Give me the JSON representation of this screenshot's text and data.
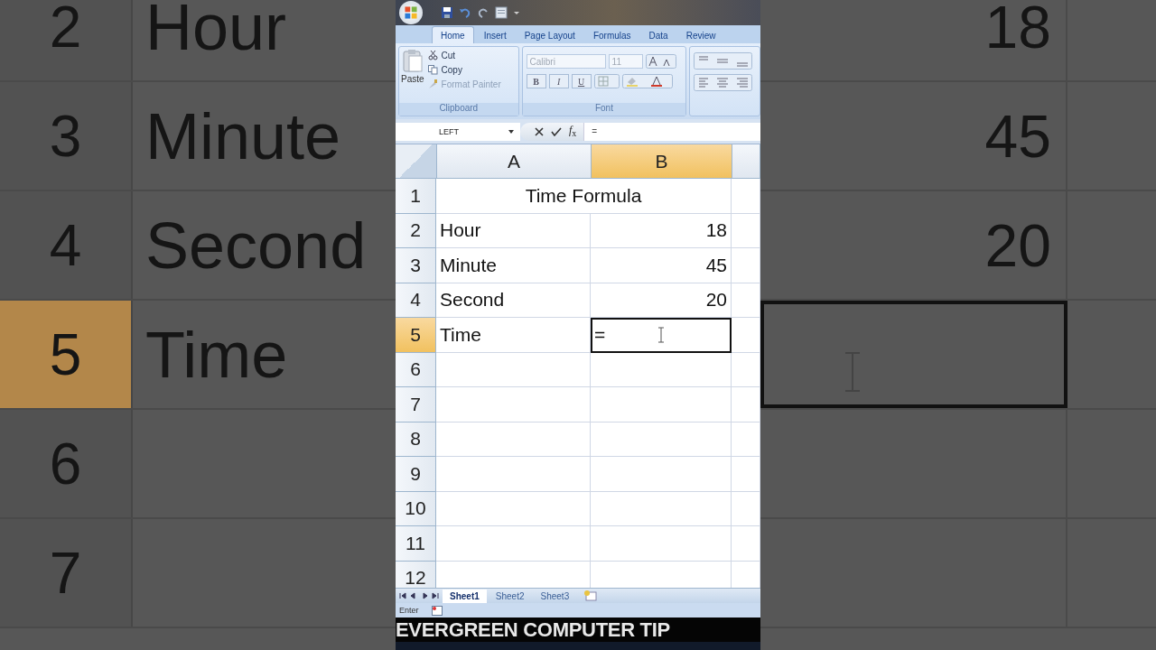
{
  "backdrop": {
    "rows": [
      {
        "number": "2",
        "label": "Hour",
        "value": "18",
        "selected": false
      },
      {
        "number": "3",
        "label": "Minute",
        "value": "45",
        "selected": false
      },
      {
        "number": "4",
        "label": "Second",
        "value": "20",
        "selected": false
      },
      {
        "number": "5",
        "label": "Time",
        "selected": true
      },
      {
        "number": "6",
        "selected": false
      },
      {
        "number": "7",
        "selected": false
      }
    ]
  },
  "ribbon": {
    "tabs": [
      {
        "label": "Home",
        "selected": true
      },
      {
        "label": "Insert",
        "selected": false
      },
      {
        "label": "Page Layout",
        "selected": false
      },
      {
        "label": "Formulas",
        "selected": false
      },
      {
        "label": "Data",
        "selected": false
      },
      {
        "label": "Review",
        "selected": false
      }
    ],
    "clipboard": {
      "paste": "Paste",
      "cut": "Cut",
      "copy": "Copy",
      "format_painter": "Format Painter",
      "label": "Clipboard"
    },
    "font": {
      "name": "Calibri",
      "size": "11",
      "bold": "B",
      "italic": "I",
      "underline": "U",
      "label": "Font"
    }
  },
  "formula_bar": {
    "name_box": "LEFT",
    "function_label": "*f*$_{x}$",
    "formula": "="
  },
  "sheet": {
    "columns": [
      {
        "label": "A",
        "selected": false
      },
      {
        "label": "B",
        "selected": true
      }
    ],
    "rows": [
      {
        "number": "1",
        "selected": false,
        "kind": "merged",
        "text": "Time Formula"
      },
      {
        "number": "2",
        "selected": false,
        "kind": "pair",
        "a": "Hour",
        "b": "18"
      },
      {
        "number": "3",
        "selected": false,
        "kind": "pair",
        "a": "Minute",
        "b": "45"
      },
      {
        "number": "4",
        "selected": false,
        "kind": "pair",
        "a": "Second",
        "b": "20"
      },
      {
        "number": "5",
        "selected": true,
        "kind": "pair",
        "a": "Time",
        "b": "=",
        "editing": true
      },
      {
        "number": "6",
        "selected": false,
        "kind": "empty"
      },
      {
        "number": "7",
        "selected": false,
        "kind": "empty"
      },
      {
        "number": "8",
        "selected": false,
        "kind": "empty"
      },
      {
        "number": "9",
        "selected": false,
        "kind": "empty"
      },
      {
        "number": "10",
        "selected": false,
        "kind": "empty"
      },
      {
        "number": "11",
        "selected": false,
        "kind": "empty"
      },
      {
        "number": "12",
        "selected": false,
        "kind": "empty"
      }
    ]
  },
  "sheet_tabs": [
    {
      "label": "Sheet1",
      "selected": true
    },
    {
      "label": "Sheet2",
      "selected": false
    },
    {
      "label": "Sheet3",
      "selected": false
    }
  ],
  "status_bar": {
    "mode": "Enter"
  },
  "banner": "EVERGREEN COMPUTER TIP"
}
